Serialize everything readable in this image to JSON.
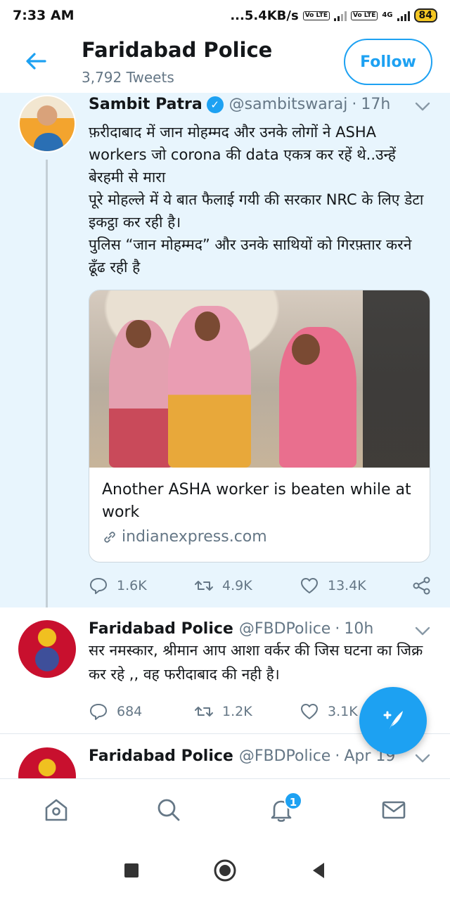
{
  "status_bar": {
    "time": "7:33 AM",
    "network_speed": "...5.4KB/s",
    "volte1": "Vo LTE",
    "volte2": "Vo LTE",
    "network_type": "4G",
    "battery": "84"
  },
  "header": {
    "title": "Faridabad Police",
    "subtitle": "3,792 Tweets",
    "follow_label": "Follow",
    "back_icon": "back-arrow-icon"
  },
  "tweets": [
    {
      "name": "Sambit Patra",
      "handle": "@sambitswaraj",
      "separator": "·",
      "time": "17h",
      "verified": true,
      "lines": [
        "फ़रीदाबाद में जान मोहम्मद और उनके लोगों ने ASHA workers जो corona की data एकत्र कर रहें थे..उन्हें बेरहमी से मारा",
        "पूरे मोहल्ले में ये बात फैलाई गयी की सरकार NRC के लिए डेटा इकट्ठा कर रही है।",
        "पुलिस “जान मोहम्मद” और उनके साथियों को गिरफ़्तार करने ढूँढ रही है"
      ],
      "card": {
        "title": "Another ASHA worker is beaten while at work",
        "domain": "indianexpress.com"
      },
      "replies": "1.6K",
      "retweets": "4.9K",
      "likes": "13.4K"
    },
    {
      "name": "Faridabad Police",
      "handle": "@FBDPolice",
      "separator": "·",
      "time": "10h",
      "text": "सर नमस्कार, श्रीमान आप आशा वर्कर की जिस घटना का जिक्र कर रहे ,, वह फरीदाबाद की नही है।",
      "replies": "684",
      "retweets": "1.2K",
      "likes": "3.1K"
    },
    {
      "name": "Faridabad Police",
      "handle": "@FBDPolice",
      "separator": "·",
      "time": "Apr 19"
    }
  ],
  "bottom_nav": {
    "items": [
      "home-icon",
      "search-icon",
      "notifications-icon",
      "messages-icon"
    ],
    "notification_count": "1"
  },
  "fab": {
    "icon": "compose-tweet-icon"
  },
  "colors": {
    "accent": "#1da1f2",
    "highlight_bg": "#e8f5fd",
    "secondary_text": "#657786"
  }
}
